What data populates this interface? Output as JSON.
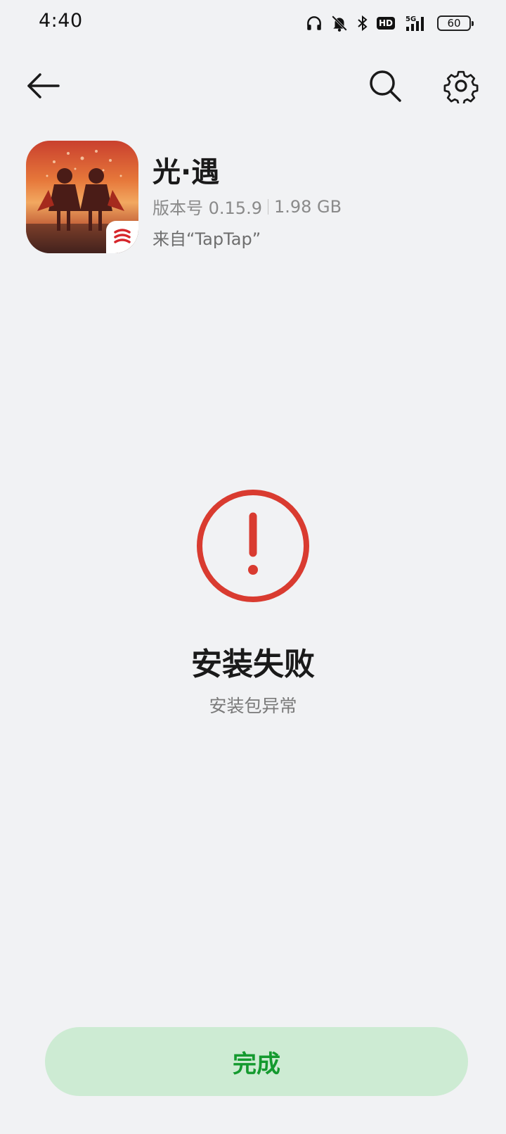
{
  "status_bar": {
    "time": "4:40",
    "battery": "60",
    "network": "5G",
    "hd_label": "HD"
  },
  "toolbar": {
    "back_icon": "arrow-left-icon",
    "search_icon": "search-icon",
    "settings_icon": "gear-icon"
  },
  "app": {
    "name": "光·遇",
    "version_label": "版本号 0.15.9",
    "size": "1.98 GB",
    "source": "来自“TapTap”"
  },
  "result": {
    "status_icon": "exclamation-circle-icon",
    "status_color": "#d93b30",
    "title": "安装失败",
    "subtitle": "安装包异常"
  },
  "actions": {
    "done_label": "完成",
    "done_color": "#149a2f",
    "done_background": "#cdebd3"
  }
}
